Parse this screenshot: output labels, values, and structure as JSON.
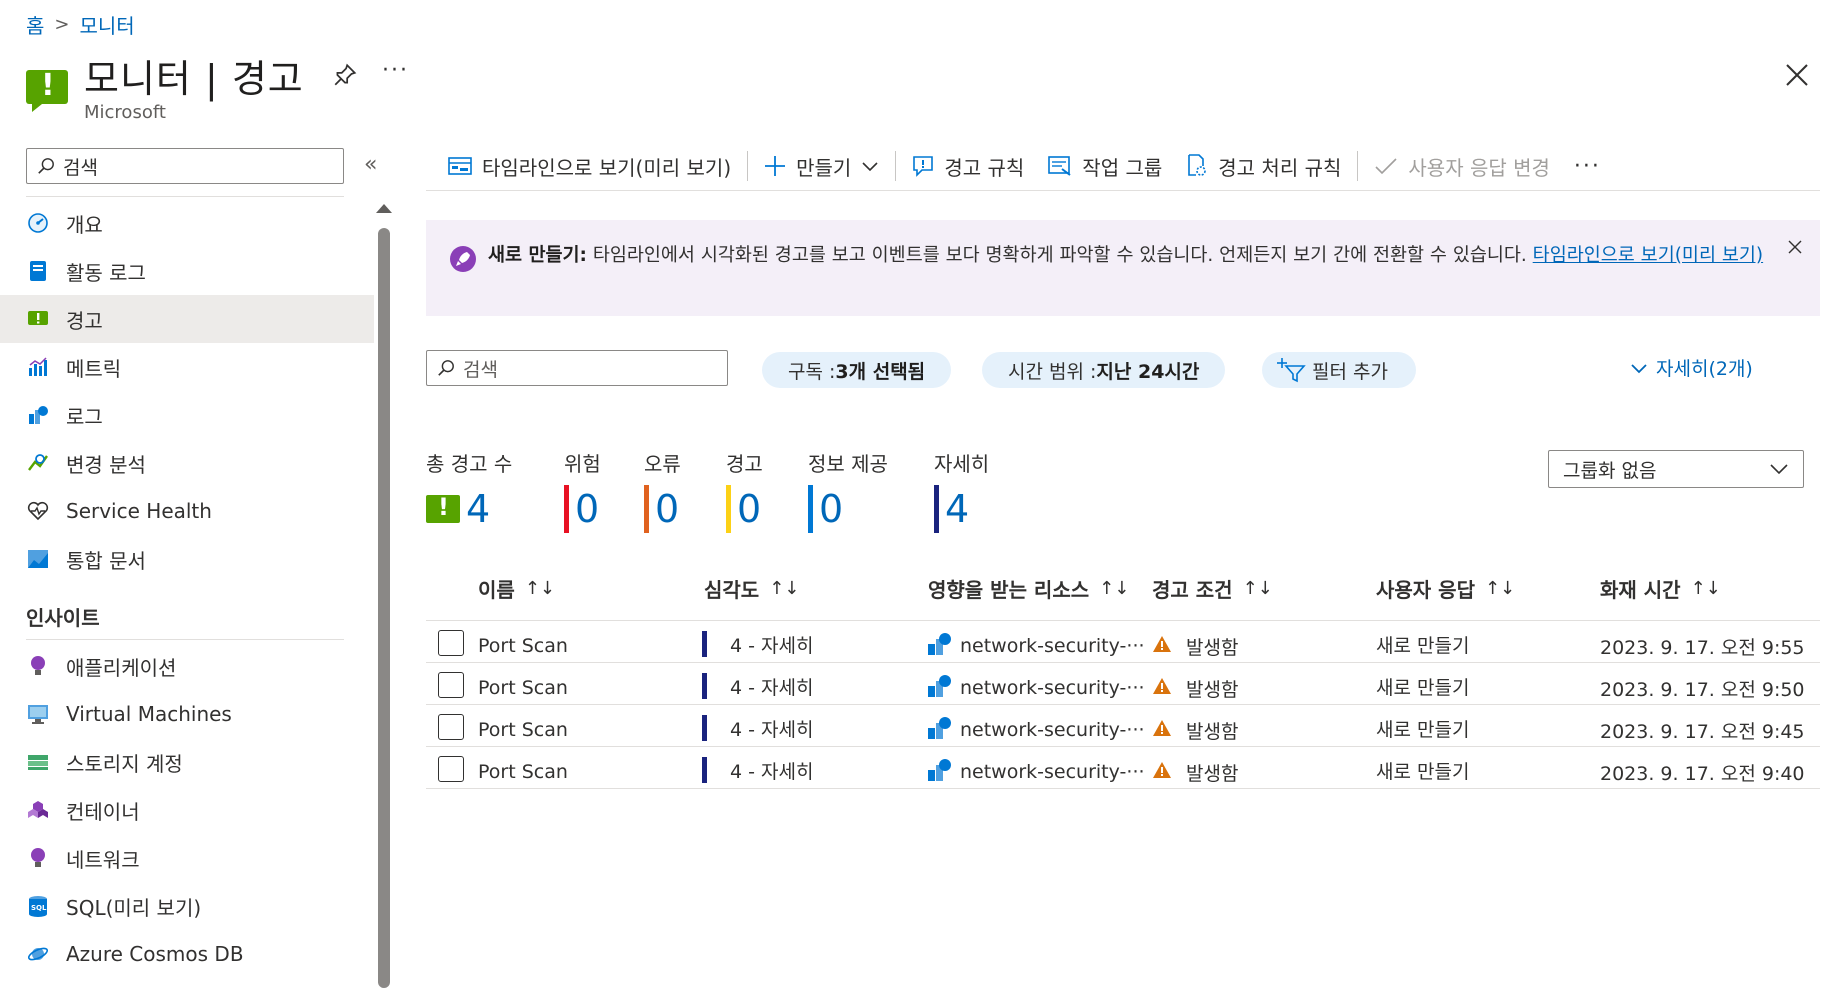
{
  "breadcrumb": {
    "home": "홈",
    "sep": ">",
    "current": "모니터"
  },
  "header": {
    "title": "모니터 | 경고",
    "subtitle": "Microsoft",
    "more": "···"
  },
  "sidebar": {
    "search_placeholder": "검색",
    "collapse": "«",
    "items": [
      {
        "label": "개요",
        "icon": "overview-gauge-icon"
      },
      {
        "label": "활동 로그",
        "icon": "activity-log-icon"
      },
      {
        "label": "경고",
        "icon": "alert-icon",
        "active": true
      },
      {
        "label": "메트릭",
        "icon": "metrics-icon"
      },
      {
        "label": "로그",
        "icon": "logs-icon"
      },
      {
        "label": "변경 분석",
        "icon": "change-analysis-icon"
      },
      {
        "label": "Service Health",
        "icon": "heart-icon"
      },
      {
        "label": "통합 문서",
        "icon": "workbook-icon"
      }
    ],
    "insights_heading": "인사이트",
    "insights": [
      {
        "label": "애플리케이션",
        "icon": "bulb-icon"
      },
      {
        "label": "Virtual Machines",
        "icon": "vm-icon"
      },
      {
        "label": "스토리지 계정",
        "icon": "storage-icon"
      },
      {
        "label": "컨테이너",
        "icon": "container-icon"
      },
      {
        "label": "네트워크",
        "icon": "network-bulb-icon"
      },
      {
        "label": "SQL(미리 보기)",
        "icon": "sql-icon"
      },
      {
        "label": "Azure Cosmos DB",
        "icon": "cosmos-icon"
      }
    ]
  },
  "toolbar": {
    "timeline": "타임라인으로 보기(미리 보기)",
    "create": "만들기",
    "alert_rules": "경고 규칙",
    "action_groups": "작업 그룹",
    "processing_rules": "경고 처리 규칙",
    "user_response": "사용자 응답 변경",
    "more": "···"
  },
  "banner": {
    "bold": "새로 만들기:",
    "text": " 타임라인에서 시각화된 경고를 보고 이벤트를 보다 명확하게 파악할 수 있습니다. 언제든지 보기 간에 전환할 수 있습니다. ",
    "link": "타임라인으로 보기(미리 보기)"
  },
  "filters": {
    "search_placeholder": "검색",
    "subscription_label": "구독 : ",
    "subscription_value": "3개 선택됨",
    "time_label": "시간 범위 : ",
    "time_value": "지난 24시간",
    "add_filter": "필터 추가",
    "details_toggle": "자세히(2개)"
  },
  "summary": {
    "total_label": "총 경고 수",
    "total": "4",
    "critical_label": "위험",
    "critical": "0",
    "critical_color": "#e81123",
    "error_label": "오류",
    "error": "0",
    "error_color": "#e0621f",
    "warning_label": "경고",
    "warning": "0",
    "warning_color": "#fcd116",
    "info_label": "정보 제공",
    "info": "0",
    "info_color": "#0078d4",
    "verbose_label": "자세히",
    "verbose": "4",
    "verbose_color": "#1a237e"
  },
  "group_by": "그룹화 없음",
  "table": {
    "headers": {
      "name": "이름",
      "severity": "심각도",
      "resource": "영향을 받는 리소스",
      "condition": "경고 조건",
      "user_response": "사용자 응답",
      "fired_time": "화재 시간"
    },
    "sort_icon": "↑↓",
    "rows": [
      {
        "name": "Port Scan",
        "severity": "4 - 자세히",
        "resource": "network-security-···",
        "condition": "발생함",
        "response": "새로 만들기",
        "time": "2023. 9. 17. 오전 9:55"
      },
      {
        "name": "Port Scan",
        "severity": "4 - 자세히",
        "resource": "network-security-···",
        "condition": "발생함",
        "response": "새로 만들기",
        "time": "2023. 9. 17. 오전 9:50"
      },
      {
        "name": "Port Scan",
        "severity": "4 - 자세히",
        "resource": "network-security-···",
        "condition": "발생함",
        "response": "새로 만들기",
        "time": "2023. 9. 17. 오전 9:45"
      },
      {
        "name": "Port Scan",
        "severity": "4 - 자세히",
        "resource": "network-security-···",
        "condition": "발생함",
        "response": "새로 만들기",
        "time": "2023. 9. 17. 오전 9:40"
      }
    ]
  },
  "colors": {
    "accent": "#0067b8",
    "alert_green": "#57a300",
    "banner_bg": "#f4eff8",
    "pill_bg": "#e5f1fb"
  }
}
